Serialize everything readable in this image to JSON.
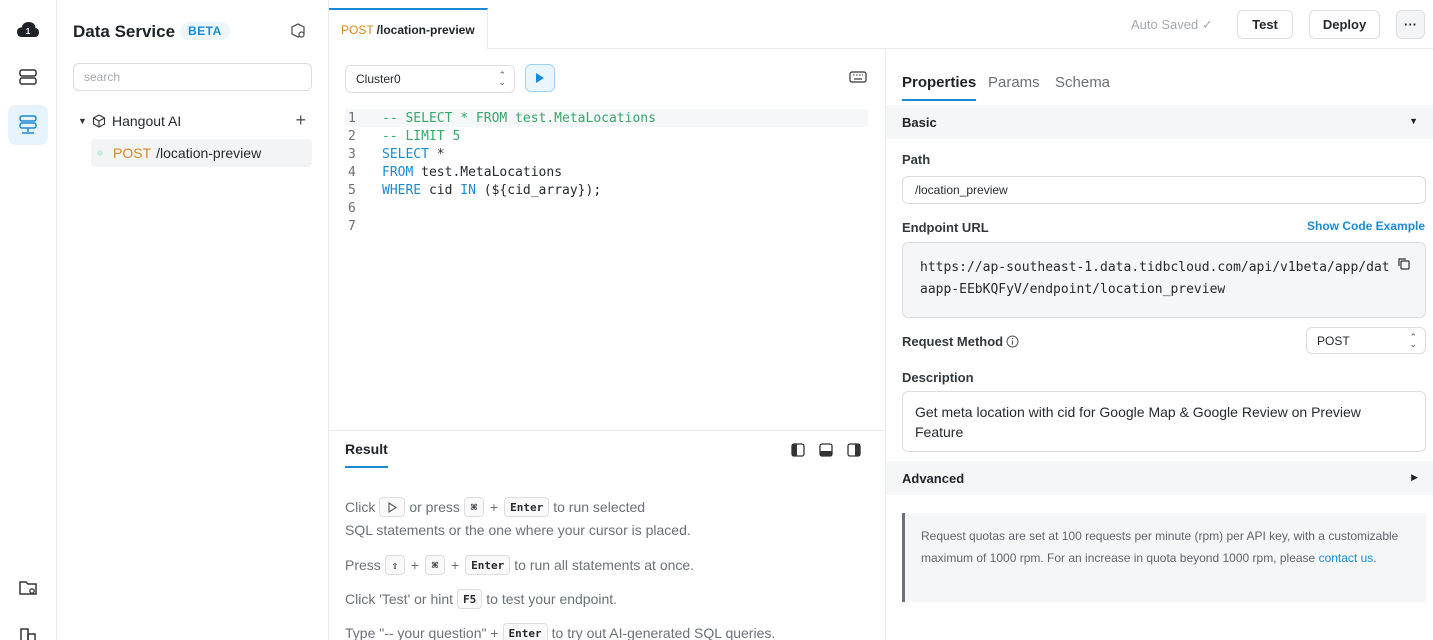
{
  "app": {
    "title": "Data Service",
    "badge": "BETA"
  },
  "sidebar": {
    "search_placeholder": "search",
    "group": {
      "label": "Hangout AI"
    },
    "endpoint": {
      "method": "POST",
      "path": "/location-preview"
    }
  },
  "header": {
    "tab": {
      "method": "POST",
      "path": "/location-preview"
    },
    "auto_saved": "Auto Saved ✓",
    "test_label": "Test",
    "deploy_label": "Deploy",
    "more_label": "···"
  },
  "editor": {
    "cluster": "Cluster0",
    "lines": [
      {
        "n": "1",
        "parts": [
          {
            "t": "-- SELECT * FROM test.MetaLocations",
            "c": "cm"
          }
        ]
      },
      {
        "n": "2",
        "parts": [
          {
            "t": "-- LIMIT 5",
            "c": "cm"
          }
        ]
      },
      {
        "n": "3",
        "parts": [
          {
            "t": "SELECT",
            "c": "kw"
          },
          {
            "t": " *",
            "c": "tx"
          }
        ]
      },
      {
        "n": "4",
        "parts": [
          {
            "t": "FROM",
            "c": "kw"
          },
          {
            "t": " test.MetaLocations",
            "c": "tx"
          }
        ]
      },
      {
        "n": "5",
        "parts": [
          {
            "t": "WHERE",
            "c": "kw"
          },
          {
            "t": " cid ",
            "c": "tx"
          },
          {
            "t": "IN",
            "c": "kw"
          },
          {
            "t": " (${cid_array});",
            "c": "tx"
          }
        ]
      },
      {
        "n": "6",
        "parts": []
      },
      {
        "n": "7",
        "parts": []
      }
    ]
  },
  "result": {
    "tab_label": "Result",
    "hint1_click": "Click",
    "hint1_or_press": "or press",
    "key_cmd": "⌘",
    "key_enter": "Enter",
    "key_shift": "⇧",
    "key_f5": "F5",
    "plus": "+",
    "hint1_tail": "to run selected",
    "hint1_line2": "SQL statements or the one where your cursor is placed.",
    "hint2_press": "Press",
    "hint2_tail": "to run all statements at once.",
    "hint3_head": "Click 'Test' or hint",
    "hint3_tail": "to test your endpoint.",
    "hint4_head": "Type \"-- your question\" +",
    "hint4_tail": "to try out AI-generated SQL queries."
  },
  "properties": {
    "tabs": [
      "Properties",
      "Params",
      "Schema"
    ],
    "basic_label": "Basic",
    "path_label": "Path",
    "path_value": "/location_preview",
    "endpoint_url_label": "Endpoint URL",
    "show_code_label": "Show Code Example",
    "endpoint_url": "https://ap-southeast-1.data.tidbcloud.com/api/v1beta/app/dataapp-EEbKQFyV/endpoint/location_preview",
    "request_method_label": "Request Method",
    "request_method_value": "POST",
    "description_label": "Description",
    "description_value": "Get meta location with cid for Google Map & Google Review on Preview Feature",
    "advanced_label": "Advanced",
    "notice_text": "Request quotas are set at 100 requests per minute (rpm) per API key, with a customizable maximum of 1000 rpm. For an increase in quota beyond 1000 rpm, please",
    "notice_link": "contact us",
    "notice_end": "."
  },
  "colors": {
    "accent": "#1a8ad8",
    "method_post": "#d9851f",
    "comment": "#36a86b"
  }
}
